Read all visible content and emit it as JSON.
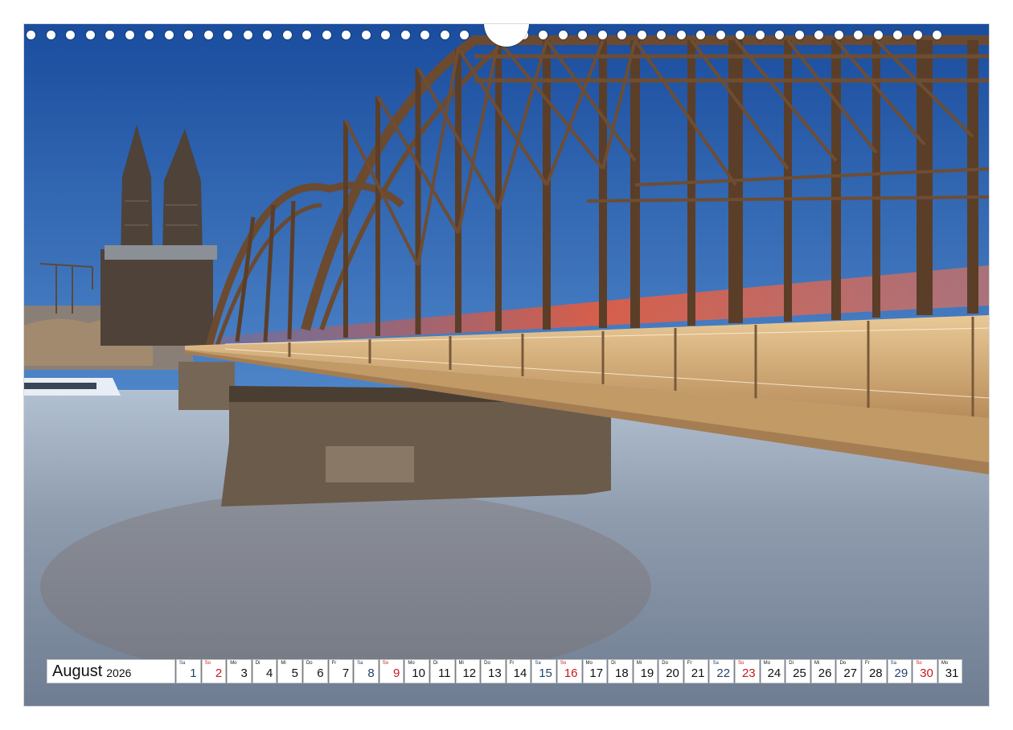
{
  "photo": {
    "subject": "Hohenzollern bridge with Cologne Cathedral over the Rhine",
    "colors": {
      "sky_top": "#1f55a6",
      "sky_bottom": "#b8cde3",
      "water": "#8b98a8",
      "steel": "#6e4a30",
      "stone": "#6b5a48",
      "train": "#e8452a"
    }
  },
  "calendar": {
    "month": "August",
    "year": "2026",
    "days": [
      {
        "wd": "Sa",
        "n": "1",
        "type": "sat"
      },
      {
        "wd": "So",
        "n": "2",
        "type": "sun"
      },
      {
        "wd": "Mo",
        "n": "3",
        "type": "wk"
      },
      {
        "wd": "Di",
        "n": "4",
        "type": "wk"
      },
      {
        "wd": "Mi",
        "n": "5",
        "type": "wk"
      },
      {
        "wd": "Do",
        "n": "6",
        "type": "wk"
      },
      {
        "wd": "Fr",
        "n": "7",
        "type": "wk"
      },
      {
        "wd": "Sa",
        "n": "8",
        "type": "sat"
      },
      {
        "wd": "So",
        "n": "9",
        "type": "sun"
      },
      {
        "wd": "Mo",
        "n": "10",
        "type": "wk"
      },
      {
        "wd": "Di",
        "n": "11",
        "type": "wk"
      },
      {
        "wd": "Mi",
        "n": "12",
        "type": "wk"
      },
      {
        "wd": "Do",
        "n": "13",
        "type": "wk"
      },
      {
        "wd": "Fr",
        "n": "14",
        "type": "wk"
      },
      {
        "wd": "Sa",
        "n": "15",
        "type": "sat"
      },
      {
        "wd": "So",
        "n": "16",
        "type": "sun"
      },
      {
        "wd": "Mo",
        "n": "17",
        "type": "wk"
      },
      {
        "wd": "Di",
        "n": "18",
        "type": "wk"
      },
      {
        "wd": "Mi",
        "n": "19",
        "type": "wk"
      },
      {
        "wd": "Do",
        "n": "20",
        "type": "wk"
      },
      {
        "wd": "Fr",
        "n": "21",
        "type": "wk"
      },
      {
        "wd": "Sa",
        "n": "22",
        "type": "sat"
      },
      {
        "wd": "So",
        "n": "23",
        "type": "sun"
      },
      {
        "wd": "Mo",
        "n": "24",
        "type": "wk"
      },
      {
        "wd": "Di",
        "n": "25",
        "type": "wk"
      },
      {
        "wd": "Mi",
        "n": "26",
        "type": "wk"
      },
      {
        "wd": "Do",
        "n": "27",
        "type": "wk"
      },
      {
        "wd": "Fr",
        "n": "28",
        "type": "wk"
      },
      {
        "wd": "Sa",
        "n": "29",
        "type": "sat"
      },
      {
        "wd": "So",
        "n": "30",
        "type": "sun"
      },
      {
        "wd": "Mo",
        "n": "31",
        "type": "wk"
      }
    ]
  }
}
